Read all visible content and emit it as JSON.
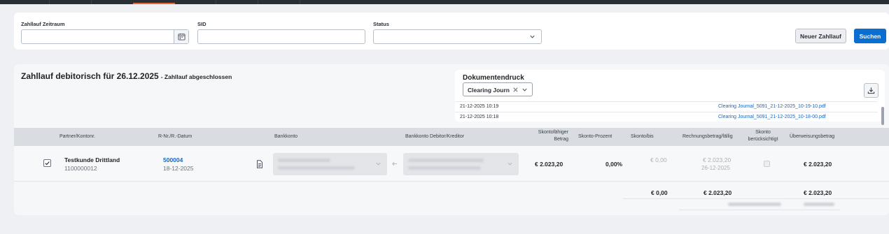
{
  "filters": {
    "zeitraum_label": "Zahllauf Zeitraum",
    "zeitraum_value": "",
    "sid_label": "SID",
    "sid_value": "",
    "status_label": "Status",
    "status_value": "",
    "new_button": "Neuer Zahllauf",
    "search_button": "Suchen"
  },
  "result": {
    "title": "Zahllauf debitorisch für 26.12.2025",
    "subtitle": "- Zahllauf abgeschlossen"
  },
  "documents": {
    "title": "Dokumentendruck",
    "selected": "Clearing Journal",
    "rows": [
      {
        "timestamp": "21-12-2025 10:19",
        "file": "Clearing Journal_5091_21-12-2025_10-19-10.pdf"
      },
      {
        "timestamp": "21-12-2025 10:18",
        "file": "Clearing Journal_5091_21-12-2025_10-18-00.pdf"
      }
    ]
  },
  "table": {
    "headers": {
      "partner": "Partner/Kontonr.",
      "rnr": "R-Nr./R.-Datum",
      "bankkonto": "Bankkonto",
      "bankkonto_deb": "Bankkonto Debitor/Kreditor",
      "skontofaehig_1": "Skontofähiger",
      "skontofaehig_2": "Betrag",
      "skonto_prozent": "Skonto-Prozent",
      "skonto_bis": "Skonto/bis",
      "rechnungsbetrag": "Rechnungsbetrag/fällig",
      "skonto_ber_1": "Skonto",
      "skonto_ber_2": "berücksichtigt",
      "ueberweisung": "Überweisungsbetrag"
    },
    "row": {
      "partner_name": "Testkunde Drittland",
      "partner_nr": "1100000012",
      "rnr": "500004",
      "rdatum": "18-12-2025",
      "skontofaehig": "€ 2.023,20",
      "skonto_prozent": "0,00%",
      "skonto_bis": "€ 0,00",
      "rechnungsbetrag": "€ 2.023,20",
      "faellig": "26-12-2025",
      "ueberweisung": "€ 2.023,20"
    },
    "totals": {
      "skonto": "€ 0,00",
      "rechnungsbetrag": "€ 2.023,20",
      "ueberweisung": "€ 2.023,20"
    }
  }
}
